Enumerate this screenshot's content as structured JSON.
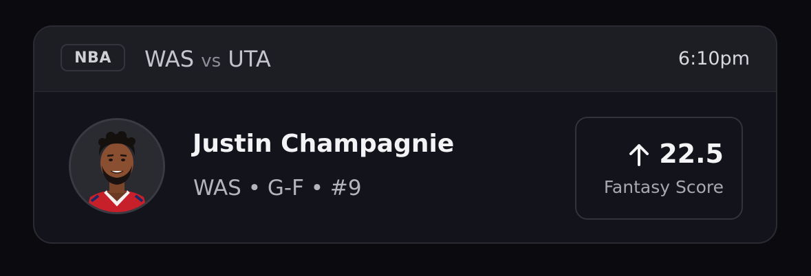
{
  "header": {
    "league": "NBA",
    "home_team": "WAS",
    "vs_label": "vs",
    "away_team": "UTA",
    "time": "6:10pm"
  },
  "player": {
    "name": "Justin Champagnie",
    "team": "WAS",
    "position": "G-F",
    "number": "#9",
    "separator": "•",
    "avatar_icon": "player-headshot"
  },
  "projection": {
    "direction_icon": "arrow-up-icon",
    "value": "22.5",
    "stat_label": "Fantasy Score"
  },
  "colors": {
    "background": "#0a0a0f",
    "card": "#13131b",
    "header": "#1d1d24",
    "jersey_red": "#c8202b"
  }
}
